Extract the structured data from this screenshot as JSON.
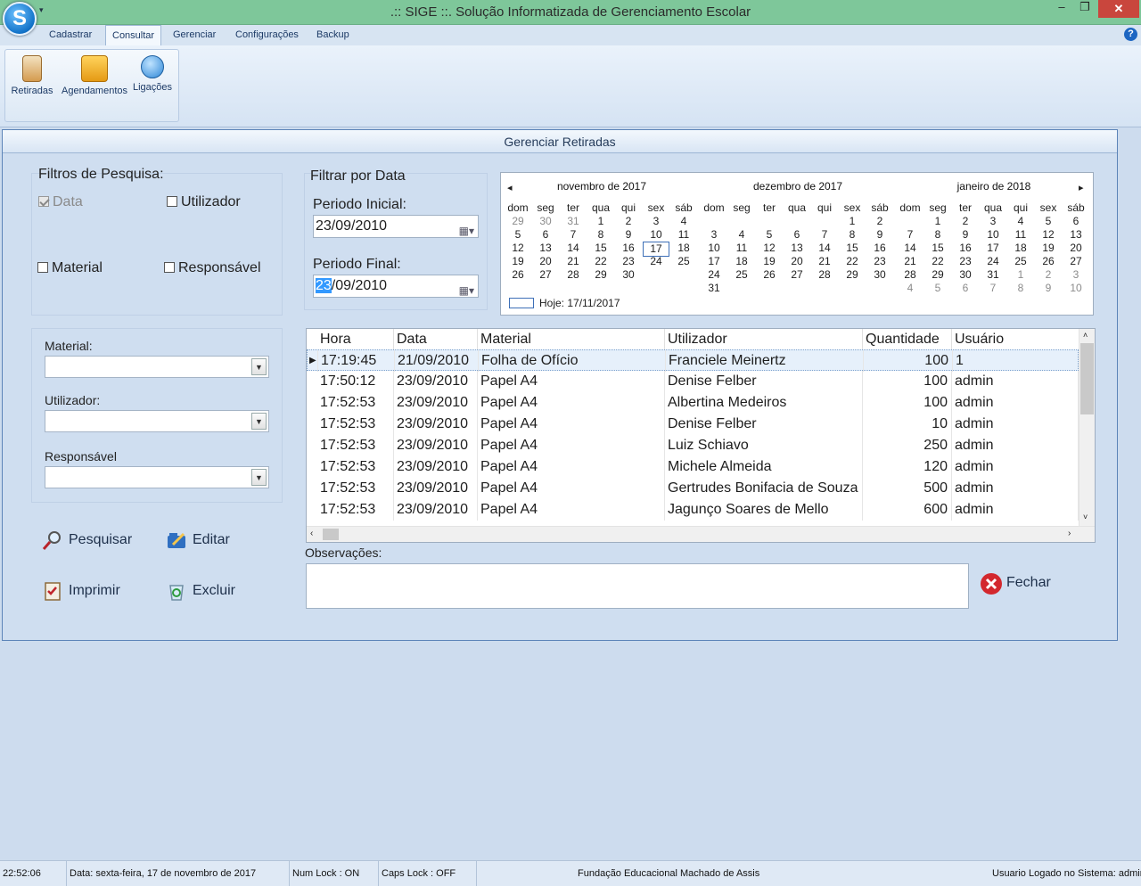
{
  "window": {
    "title": ".:: SIGE ::. Solução Informatizada de Gerenciamento Escolar",
    "orb_letter": "S",
    "min": "‒",
    "max": "❐",
    "close": "✕"
  },
  "ribbon": {
    "tabs": [
      "Cadastrar",
      "Consultar",
      "Gerenciar",
      "Configurações",
      "Backup"
    ],
    "active_tab": "Consultar",
    "buttons": [
      {
        "label": "Retiradas",
        "icon": "clipboard-icon"
      },
      {
        "label": "Agendamentos",
        "icon": "calendar-clock-icon"
      },
      {
        "label": "Ligações",
        "icon": "phone-icon"
      }
    ],
    "help": "?"
  },
  "form": {
    "title": "Gerenciar Retiradas",
    "filters_title": "Filtros de Pesquisa:",
    "checks": {
      "data": "Data",
      "utilizador": "Utilizador",
      "material": "Material",
      "responsavel": "Responsável"
    },
    "date_filter_title": "Filtrar por Data",
    "periodo_inicial_label": "Periodo Inicial:",
    "periodo_inicial": "23/09/2010",
    "periodo_final_label": "Periodo Final:",
    "periodo_final_sel": "23",
    "periodo_final_rest": "/09/2010",
    "material_label": "Material:",
    "utilizador_label": "Utilizador:",
    "responsavel_label": "Responsável",
    "obs_label": "Observações:"
  },
  "calendar": {
    "prev": "◂",
    "next": "▸",
    "weekdays": [
      "dom",
      "seg",
      "ter",
      "qua",
      "qui",
      "sex",
      "sáb"
    ],
    "months": [
      "novembro de 2017",
      "dezembro de 2017",
      "janeiro de 2018"
    ],
    "today_label": "Hoje: 17/11/2017"
  },
  "grid": {
    "columns": [
      "Hora",
      "Data",
      "Material",
      "Utilizador",
      "Quantidade",
      "Usuário"
    ],
    "rows": [
      [
        "17:19:45",
        "21/09/2010",
        "Folha de Ofício",
        "Franciele Meinertz",
        "100",
        "1"
      ],
      [
        "17:50:12",
        "23/09/2010",
        "Papel A4",
        "Denise Felber",
        "100",
        "admin"
      ],
      [
        "17:52:53",
        "23/09/2010",
        "Papel A4",
        "Albertina Medeiros",
        "100",
        "admin"
      ],
      [
        "17:52:53",
        "23/09/2010",
        "Papel A4",
        "Denise Felber",
        "10",
        "admin"
      ],
      [
        "17:52:53",
        "23/09/2010",
        "Papel A4",
        "Luiz Schiavo",
        "250",
        "admin"
      ],
      [
        "17:52:53",
        "23/09/2010",
        "Papel A4",
        "Michele Almeida",
        "120",
        "admin"
      ],
      [
        "17:52:53",
        "23/09/2010",
        "Papel A4",
        "Gertrudes Bonifacia de Souza",
        "500",
        "admin"
      ],
      [
        "17:52:53",
        "23/09/2010",
        "Papel A4",
        "Jagunço Soares de Mello",
        "600",
        "admin"
      ]
    ],
    "row_indicator": "▶"
  },
  "actions": {
    "pesquisar": "Pesquisar",
    "editar": "Editar",
    "imprimir": "Imprimir",
    "excluir": "Excluir",
    "fechar": "Fechar"
  },
  "status": {
    "time": "22:52:06",
    "date": "Data: sexta-feira, 17 de novembro de 2017",
    "numlock": "Num Lock : ON",
    "capslock": "Caps Lock : OFF",
    "org": "Fundação Educacional Machado de Assis",
    "user": "Usuario Logado no Sistema: admin"
  },
  "colors": {
    "title_bar": "#7ec79a",
    "accent": "#3399ff",
    "close": "#c9463d"
  }
}
